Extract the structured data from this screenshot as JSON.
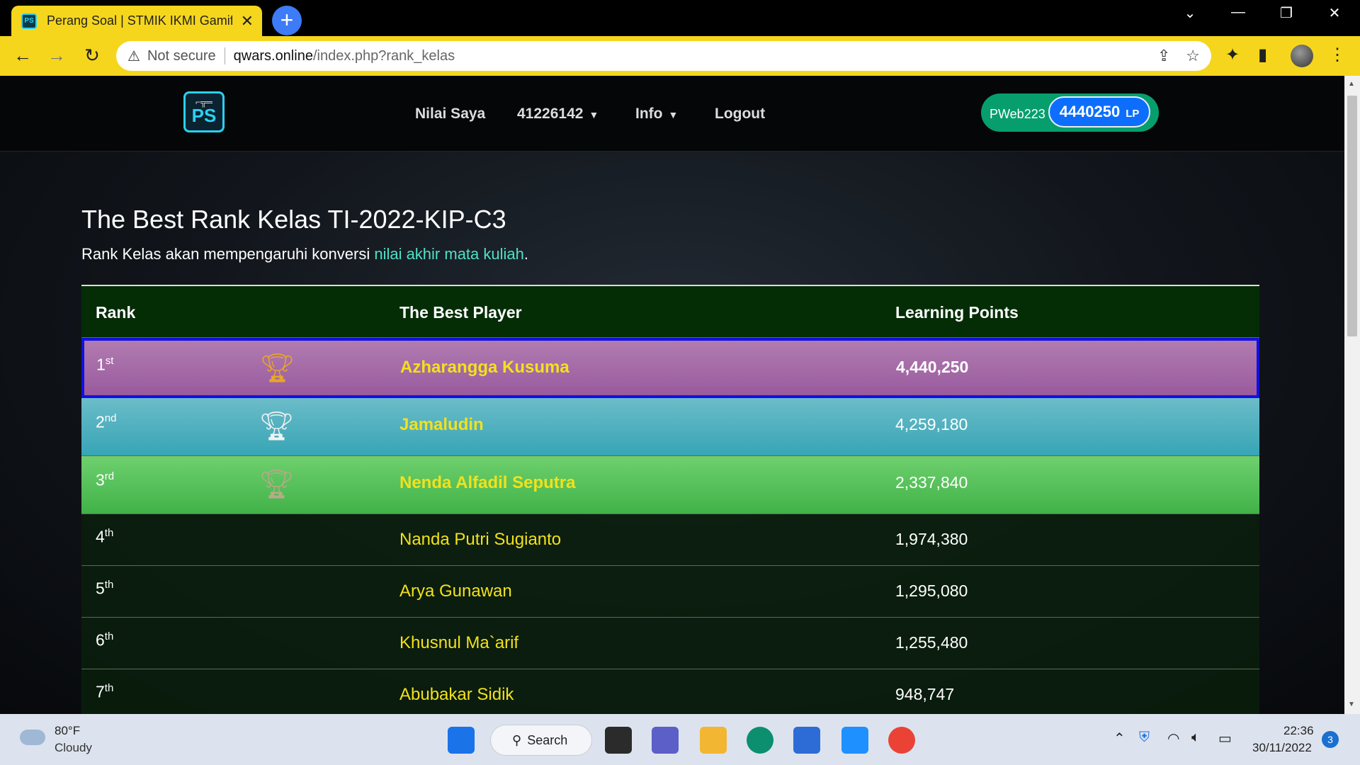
{
  "browser": {
    "tab_title": "Perang Soal | STMIK IKMI Gamifica",
    "tab_close": "✕",
    "favicon_text": "PS",
    "new_tab": "+",
    "security_label": "Not secure",
    "url_host": "qwars.online",
    "url_path": "/index.php?rank_kelas"
  },
  "navbar": {
    "logo_text": "PS",
    "links": [
      "Nilai Saya",
      "41226142",
      "Info",
      "Logout"
    ],
    "username": "PWeb223",
    "points": "4440250",
    "points_unit": "LP"
  },
  "heading": "The Best Rank Kelas TI-2022-KIP-C3",
  "subheading": {
    "before": "Rank Kelas akan mempengaruhi konversi ",
    "highlight": "nilai akhir mata kuliah",
    "after": "."
  },
  "table": {
    "headers": [
      "Rank",
      "The Best Player",
      "Learning Points"
    ],
    "rows": [
      {
        "rank": "1",
        "suffix": "st",
        "name": "Azharangga Kusuma",
        "points": "4,440,250"
      },
      {
        "rank": "2",
        "suffix": "nd",
        "name": "Jamaludin",
        "points": "4,259,180"
      },
      {
        "rank": "3",
        "suffix": "rd",
        "name": "Nenda Alfadil Seputra",
        "points": "2,337,840"
      },
      {
        "rank": "4",
        "suffix": "th",
        "name": "Nanda Putri Sugianto",
        "points": "1,974,380"
      },
      {
        "rank": "5",
        "suffix": "th",
        "name": "Arya Gunawan",
        "points": "1,295,080"
      },
      {
        "rank": "6",
        "suffix": "th",
        "name": "Khusnul Ma`arif",
        "points": "1,255,480"
      },
      {
        "rank": "7",
        "suffix": "th",
        "name": "Abubakar Sidik",
        "points": "948,747"
      }
    ],
    "colors": {
      "gold": "#e8a628",
      "silver": "#f2f2f2",
      "bronze": "#b8a98a"
    }
  },
  "taskbar": {
    "temp": "80°F",
    "condition": "Cloudy",
    "search_label": "Search",
    "time": "22:36",
    "date": "30/11/2022",
    "notifications": "3"
  }
}
